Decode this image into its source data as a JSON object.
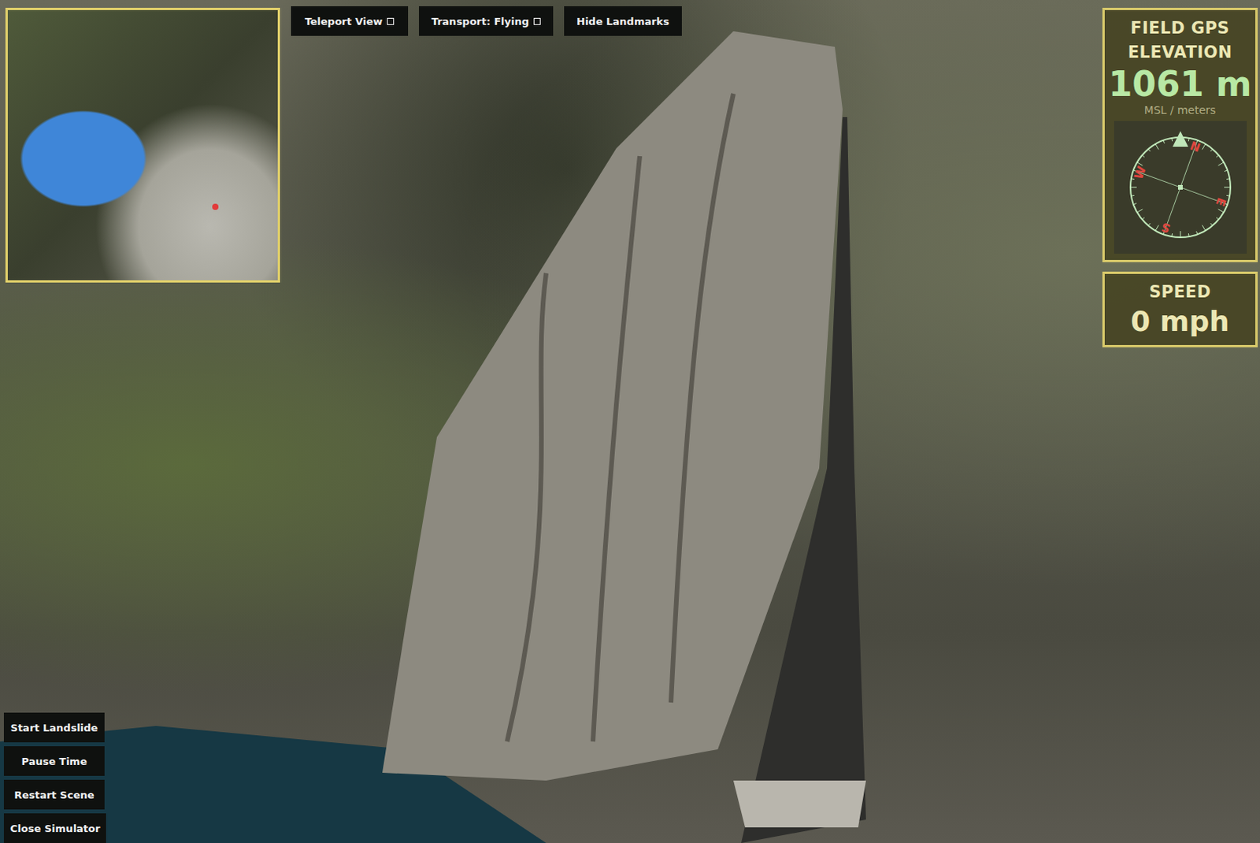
{
  "top_buttons": [
    {
      "label": "Teleport View",
      "kind": "toggle",
      "checked": false
    },
    {
      "label": "Transport: Flying",
      "kind": "toggle",
      "checked": false
    },
    {
      "label": "Hide Landmarks",
      "kind": "button",
      "checked": false
    }
  ],
  "gps": {
    "title_lines": [
      "FIELD GPS",
      "ELEVATION"
    ],
    "value": "1061 m",
    "unit": "MSL / meters",
    "compass": {
      "heading_deg": 20,
      "labels": [
        "N",
        "E",
        "S",
        "W"
      ]
    }
  },
  "speed": {
    "title": "SPEED",
    "value": "0 mph"
  },
  "bottom_buttons": [
    "Start Landslide",
    "Pause Time",
    "Restart Scene",
    "Close Simulator"
  ]
}
